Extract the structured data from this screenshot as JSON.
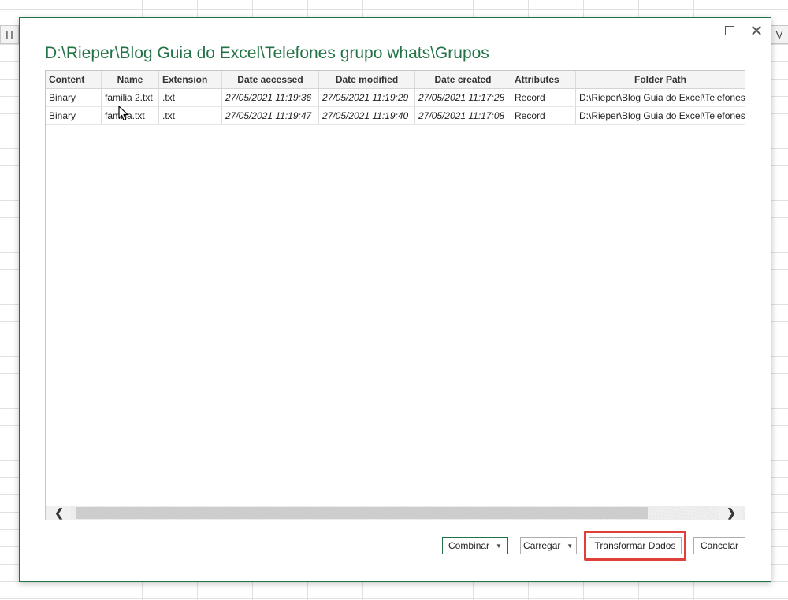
{
  "excel": {
    "col_left": "H",
    "col_right": "V"
  },
  "dialog": {
    "title": "D:\\Rieper\\Blog Guia do Excel\\Telefones grupo whats\\Grupos",
    "columns": [
      "Content",
      "Name",
      "Extension",
      "Date accessed",
      "Date modified",
      "Date created",
      "Attributes",
      "Folder Path"
    ],
    "rows": [
      [
        "Binary",
        "familia 2.txt",
        ".txt",
        "27/05/2021 11:19:36",
        "27/05/2021 11:19:29",
        "27/05/2021 11:17:28",
        "Record",
        "D:\\Rieper\\Blog Guia do Excel\\Telefones"
      ],
      [
        "Binary",
        "familia.txt",
        ".txt",
        "27/05/2021 11:19:47",
        "27/05/2021 11:19:40",
        "27/05/2021 11:17:08",
        "Record",
        "D:\\Rieper\\Blog Guia do Excel\\Telefones"
      ]
    ],
    "buttons": {
      "combinar": "Combinar",
      "carregar": "Carregar",
      "transformar": "Transformar Dados",
      "cancelar": "Cancelar"
    },
    "icons": {
      "maximize": "maximize-icon",
      "close": "close-icon",
      "cursor": "mouse-cursor-icon",
      "scroll_left": "chevron-left-icon",
      "scroll_right": "chevron-right-icon",
      "dropdown": "caret-down-icon"
    },
    "glyphs": {
      "close": "✕",
      "left": "❮",
      "right": "❯",
      "caret": "▼"
    },
    "colors": {
      "accent": "#217346",
      "highlight": "#e0403a"
    }
  }
}
